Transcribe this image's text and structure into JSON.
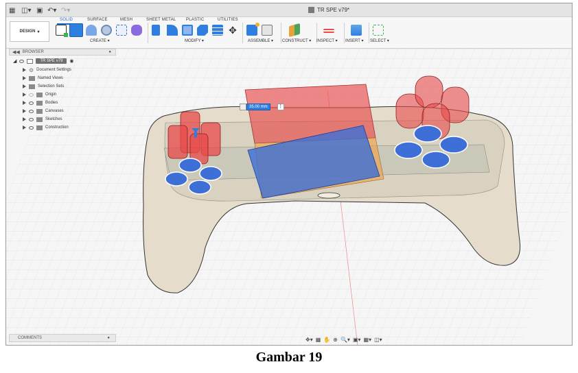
{
  "app": {
    "doc_title": "TR SPE v79*"
  },
  "tabs": [
    "SOLID",
    "SURFACE",
    "MESH",
    "SHEET METAL",
    "PLASTIC",
    "UTILITIES"
  ],
  "workspace": {
    "label": "DESIGN"
  },
  "toolbar_groups": {
    "create": "CREATE",
    "modify": "MODIFY",
    "assemble": "ASSEMBLE",
    "construct": "CONSTRUCT",
    "inspect": "INSPECT",
    "insert": "INSERT",
    "select": "SELECT"
  },
  "browser": {
    "title": "BROWSER",
    "root": "TR SPE v79",
    "items": [
      "Document Settings",
      "Named Views",
      "Selection Sets",
      "Origin",
      "Bodies",
      "Canvases",
      "Sketches",
      "Construction"
    ]
  },
  "comments": {
    "title": "COMMENTS"
  },
  "dimension": {
    "value": "35.00 mm"
  },
  "caption": "Gambar 19",
  "colors": {
    "accent": "#1e6ad1",
    "red_body": "#e84a4a",
    "blue_body": "#3d6fd6",
    "controller": "#e6dccb"
  }
}
